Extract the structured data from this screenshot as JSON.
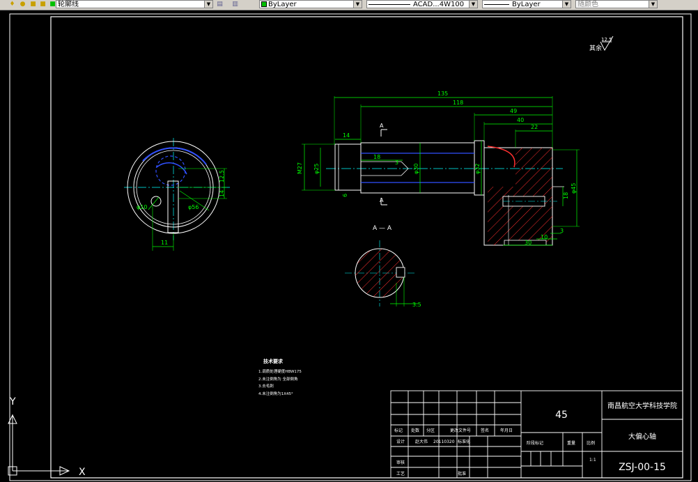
{
  "toolbar": {
    "layer_name": "轮廓线",
    "color_value": "ByLayer",
    "linetype_value": "ACAD...4W100",
    "lineweight_value": "ByLayer",
    "plotstyle_value": "随颜色"
  },
  "ucs": {
    "x_label": "X",
    "y_label": "Y"
  },
  "drawing": {
    "roughness_note": "其余",
    "roughness_value": "12.5",
    "section_label": "A — A",
    "section_marker": "A",
    "dims": {
      "d135": "135",
      "d118": "118",
      "d49": "49",
      "d40": "40",
      "d22": "22",
      "d14": "14",
      "d18": "18",
      "d3": "3",
      "m27": "M27",
      "phi25": "φ25",
      "phi30": "φ30",
      "phi32": "φ32",
      "phi45": "φ45",
      "d6": "6",
      "d18b": "18",
      "d30": "30",
      "d10": "10",
      "d3b": "3",
      "d11": "11",
      "d125": "12.5",
      "d14b": "14",
      "d35": "3.5"
    },
    "tech_requirements": {
      "title": "技术要求",
      "lines": [
        "1.调质处理硬度HBW175",
        "2.未注倒角为 全部倒角",
        "3.去毛刺",
        "4.未注倒角为1X45°"
      ]
    }
  },
  "title_block": {
    "material": "45",
    "school": "南昌航空大学科技学院",
    "part_name": "大偏心轴",
    "drawing_no": "ZSJ-00-15",
    "row_labels": [
      "标记",
      "处数",
      "分区",
      "更改文件号",
      "签名",
      "年月日"
    ],
    "designer": "设计",
    "designer_name": "赵大伟",
    "date": "20110320",
    "std": "标准化",
    "stage": "阶段标记",
    "weight": "重量",
    "scale": "比例",
    "scale_value": "1:1",
    "review": "审核",
    "process": "工艺",
    "approve": "批准"
  }
}
